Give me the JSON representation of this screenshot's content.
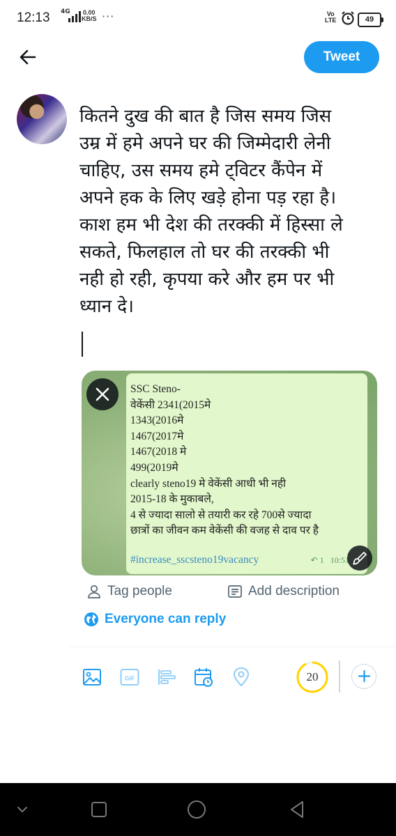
{
  "status_bar": {
    "time": "12:13",
    "network": "4G",
    "speed_value": "0.00",
    "speed_unit": "KB/S",
    "more": "···",
    "volte_top": "Vo",
    "volte_bottom": "LTE",
    "battery": "49"
  },
  "header": {
    "tweet_button": "Tweet"
  },
  "composer": {
    "text": "कितने दुख की बात है जिस समय जिस\nउम्र में हमे अपने घर की जिम्मेदारी लेनी\nचाहिए, उस समय हमे ट्विटर कैंपेन में\nअपने हक के लिए खड़े होना पड़ रहा है।\nकाश हम भी देश की तरक्की में हिस्सा ले\nसकते, फिलहाल तो घर की तरक्की भी\nनही हो रही, कृपया करे और हम पर भी\nध्यान दे।"
  },
  "media": {
    "lines": [
      "SSC Steno-",
      "वेकेंसी 2341(2015मे",
      "1343(2016मे",
      "1467(2017मे",
      "1467(2018 मे",
      "499(2019मे",
      "clearly steno19 मे वेकेंसी आधी भी नही",
      "2015-18 के मुकाबले,",
      "4 से ज्यादा सालो से तयारी कर रहे 700से ज्यादा",
      "छात्रों का जीवन कम वेकेंसी की वजह से दाव पर है"
    ],
    "hashtag": "#increase_sscsteno19vacancy",
    "reply_count": "1",
    "time": "10:51"
  },
  "actions": {
    "tag_people": "Tag people",
    "add_description": "Add description",
    "everyone_can_reply": "Everyone can reply"
  },
  "toolbar": {
    "gif_label": "GIF",
    "char_counter": "20",
    "counter_progress": 0.93
  },
  "colors": {
    "accent": "#1d9bf0",
    "counter_ring": "#ffd400"
  }
}
